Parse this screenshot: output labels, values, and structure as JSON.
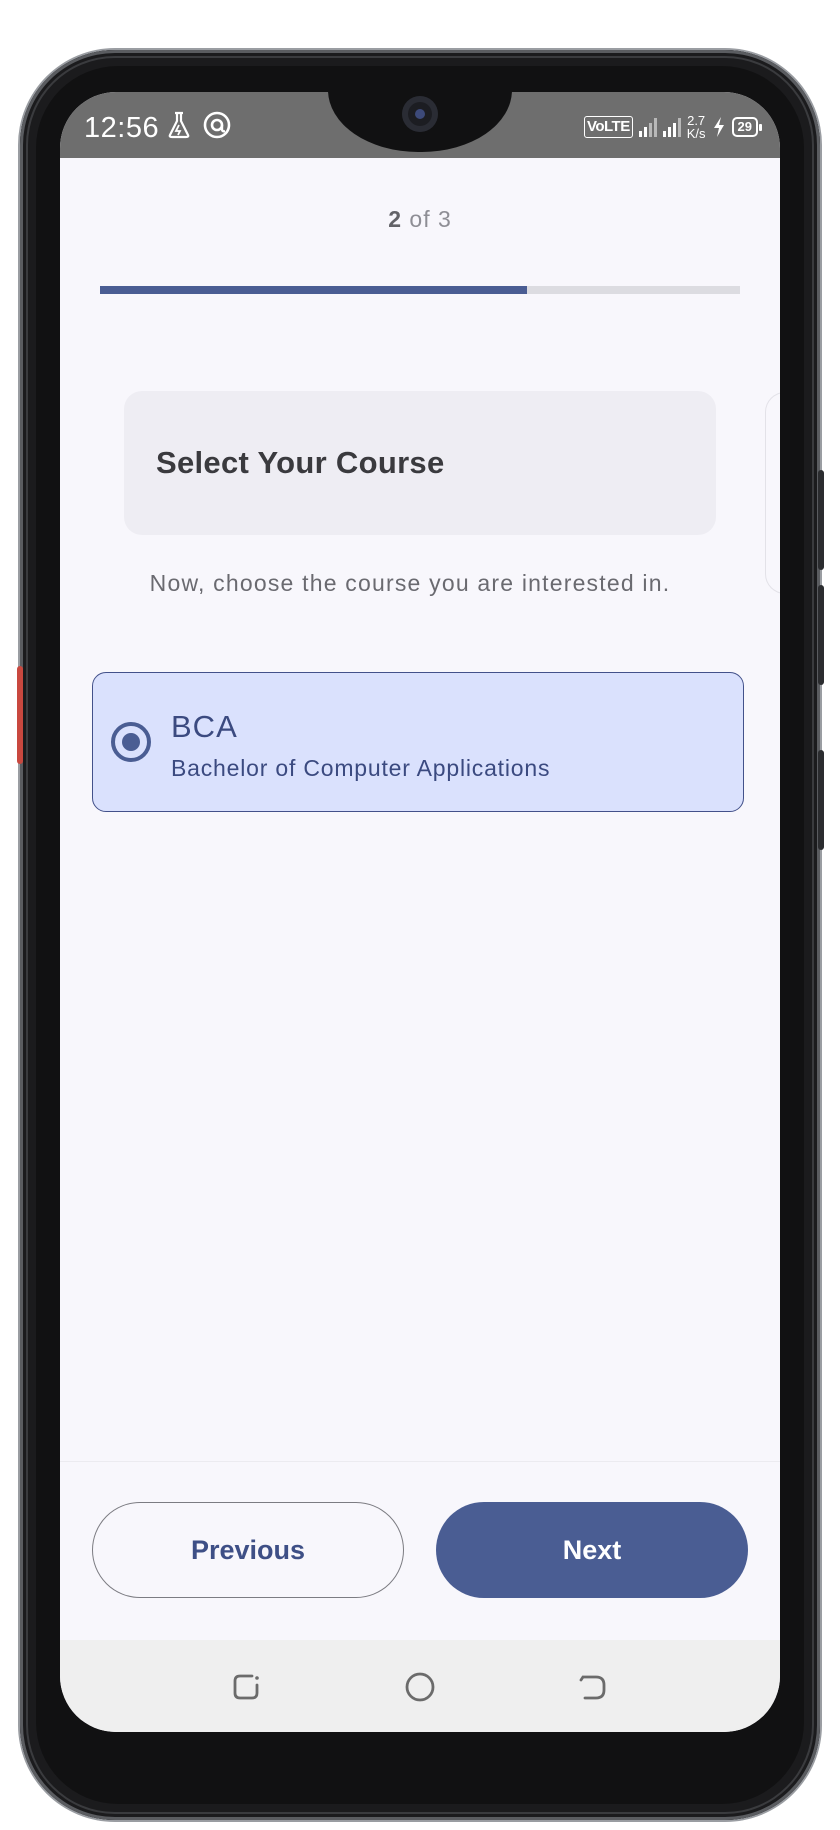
{
  "status_bar": {
    "time": "12:56",
    "network_type": "VoLTE",
    "speed_value": "2.7",
    "speed_unit": "K/s",
    "battery_level": "29",
    "icons": [
      "flask-icon",
      "at-sign-icon",
      "signal-icon",
      "charging-icon",
      "battery-icon"
    ]
  },
  "step_indicator": {
    "current": "2",
    "of_text": "of 3",
    "progress_fraction": 0.667
  },
  "header": {
    "title": "Select Your Course"
  },
  "instructions": "Now, choose the course you are interested in.",
  "courses": [
    {
      "code": "BCA",
      "name": "Bachelor of Computer Applications",
      "selected": true
    }
  ],
  "actions": {
    "previous_label": "Previous",
    "next_label": "Next"
  },
  "navigation_bar": {
    "icons": [
      "recent-apps-icon",
      "home-icon",
      "back-icon"
    ]
  },
  "colors": {
    "accent": "#4a5d93",
    "selected_background": "#dae1fd",
    "screen_background": "#f8f7fc",
    "status_bar": "#6e6e6e"
  }
}
